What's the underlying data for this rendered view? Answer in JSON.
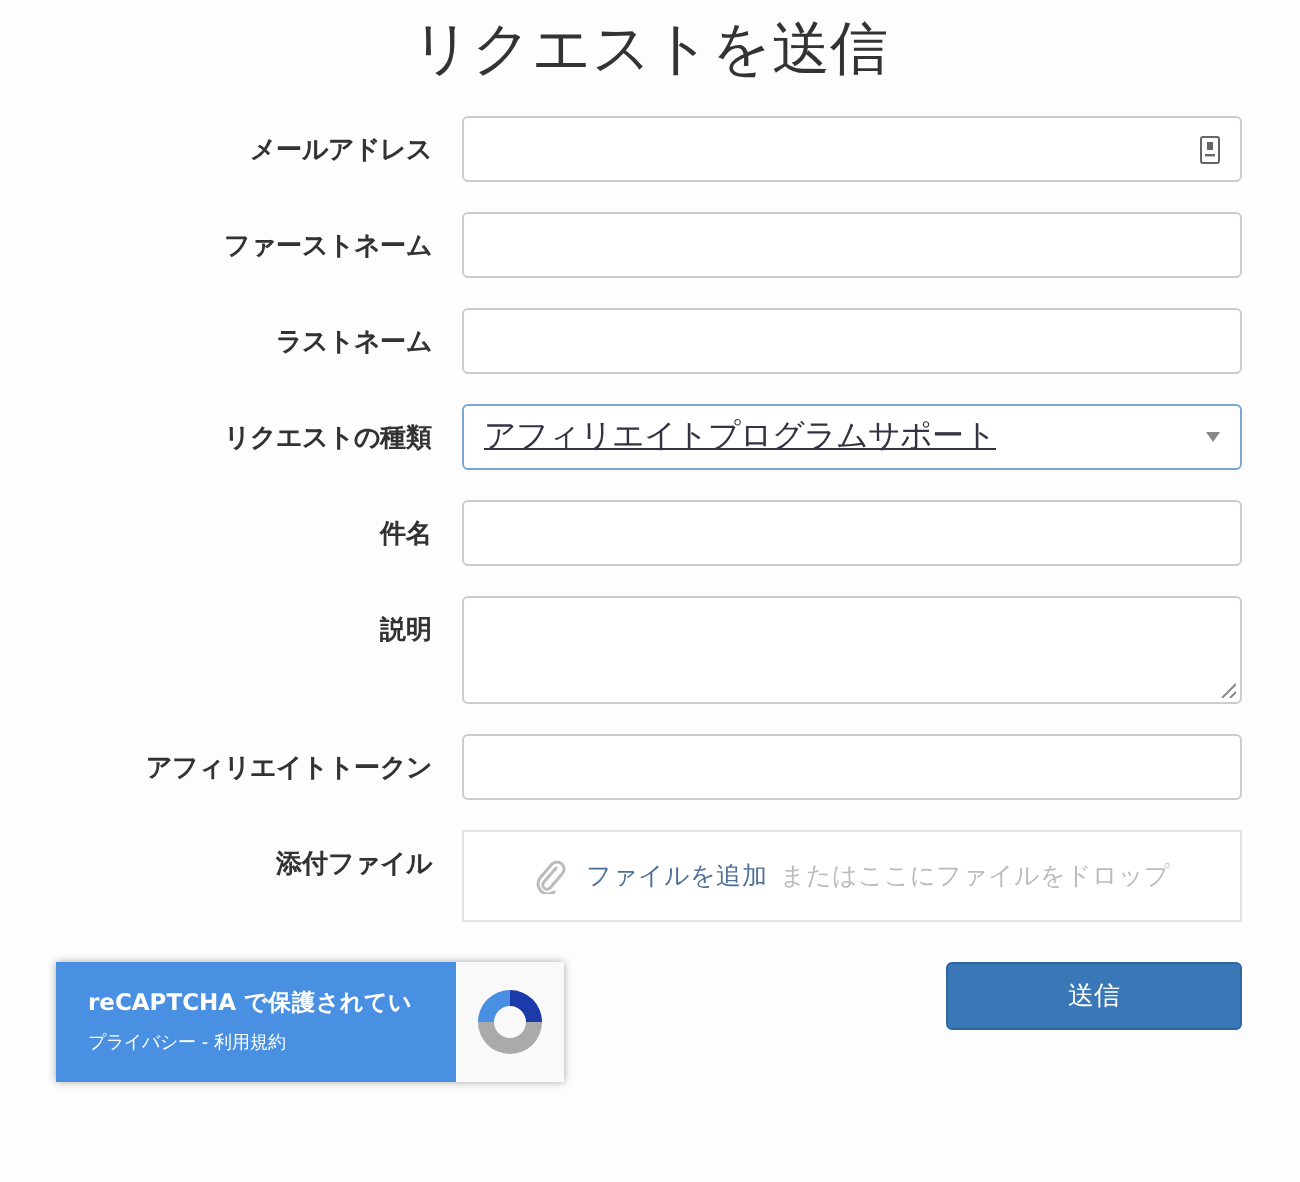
{
  "title": "リクエストを送信",
  "fields": [
    {
      "label": "メールアドレス",
      "kind": "email"
    },
    {
      "label": "ファーストネーム",
      "kind": "text"
    },
    {
      "label": "ラストネーム",
      "kind": "text"
    },
    {
      "label": "リクエストの種類",
      "kind": "select",
      "value": "アフィリエイトプログラムサポート"
    },
    {
      "label": "件名",
      "kind": "text"
    },
    {
      "label": "説明",
      "kind": "textarea"
    },
    {
      "label": "アフィリエイトトークン",
      "kind": "text"
    },
    {
      "label": "添付ファイル",
      "kind": "file",
      "link": "ファイルを追加",
      "hint": "またはここにファイルをドロップ"
    }
  ],
  "recaptcha": {
    "title": "reCAPTCHA で保護されてい",
    "links": "プライバシー - 利用規約"
  },
  "submit": "送信"
}
